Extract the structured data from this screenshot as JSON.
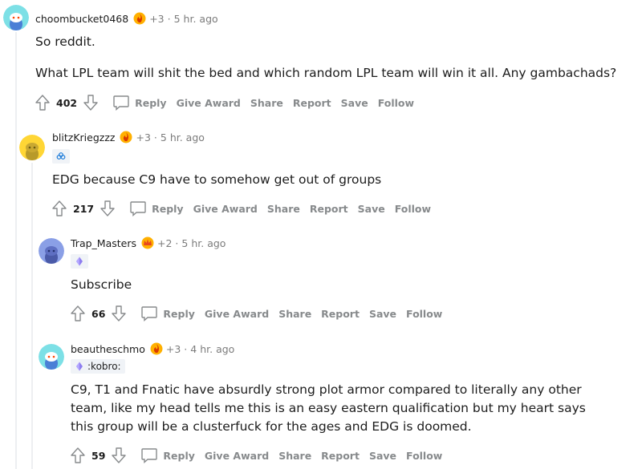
{
  "comments": [
    {
      "username": "choombucket0468",
      "award_bonus": "+3",
      "separator": "·",
      "time": "5 hr. ago",
      "flair": null,
      "body": [
        "So reddit.",
        "What LPL team will shit the bed and which random LPL team will win it all. Any gambachads?"
      ],
      "score": "402",
      "actions": {
        "reply": "Reply",
        "give_award": "Give Award",
        "share": "Share",
        "report": "Report",
        "save": "Save",
        "follow": "Follow"
      },
      "avatar_color": "#7de0e6",
      "award_icon": "fire-award-icon"
    },
    {
      "username": "blitzKriegzzz",
      "award_bonus": "+3",
      "separator": "·",
      "time": "5 hr. ago",
      "flair": {
        "text": "",
        "icon": "cloud9-flair-icon"
      },
      "body": [
        "EDG because C9 have to somehow get out of groups"
      ],
      "score": "217",
      "actions": {
        "reply": "Reply",
        "give_award": "Give Award",
        "share": "Share",
        "report": "Report",
        "save": "Save",
        "follow": "Follow"
      },
      "avatar_color": "#ffd635",
      "award_icon": "fire-award-icon"
    },
    {
      "username": "Trap_Masters",
      "award_bonus": "+2",
      "separator": "·",
      "time": "5 hr. ago",
      "flair": {
        "text": "",
        "icon": "crystal-flair-icon"
      },
      "body": [
        "Subscribe"
      ],
      "score": "66",
      "actions": {
        "reply": "Reply",
        "give_award": "Give Award",
        "share": "Share",
        "report": "Report",
        "save": "Save",
        "follow": "Follow"
      },
      "avatar_color": "#8a9fe6",
      "award_icon": "crown-award-icon"
    },
    {
      "username": "beautheschmo",
      "award_bonus": "+3",
      "separator": "·",
      "time": "4 hr. ago",
      "flair": {
        "text": ":kobro:",
        "icon": "crystal-flair-icon"
      },
      "body": [
        "C9, T1 and Fnatic have absurdly strong plot armor compared to literally any other team, like my head tells me this is an easy eastern qualification but my heart says this group will be a clusterfuck for the ages and EDG is doomed."
      ],
      "score": "59",
      "actions": {
        "reply": "Reply",
        "give_award": "Give Award",
        "share": "Share",
        "report": "Report",
        "save": "Save",
        "follow": "Follow"
      },
      "avatar_color": "#7de0e6",
      "award_icon": "fire-award-icon"
    }
  ],
  "colors": {
    "thread_line": "#edeff1",
    "meta_gray": "#7c7c7c",
    "action_gray": "#878a8c",
    "flair_bg": "#f0f3f7"
  }
}
